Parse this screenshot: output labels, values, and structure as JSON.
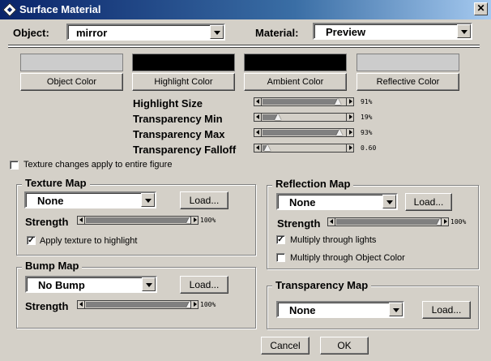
{
  "window": {
    "title": "Surface Material",
    "close_glyph": "✕"
  },
  "object": {
    "label": "Object:",
    "value": "mirror"
  },
  "material": {
    "label": "Material:",
    "value": "Preview"
  },
  "colors": {
    "object": {
      "label": "Object Color",
      "swatch": "#cccccc"
    },
    "highlight": {
      "label": "Highlight Color",
      "swatch": "#000000"
    },
    "ambient": {
      "label": "Ambient Color",
      "swatch": "#000000"
    },
    "reflective": {
      "label": "Reflective Color",
      "swatch": "#cccccc"
    }
  },
  "sliders": {
    "highlight_size": {
      "label": "Highlight Size",
      "value": 0.91,
      "display": "91%"
    },
    "transparency_min": {
      "label": "Transparency Min",
      "value": 0.19,
      "display": "19%"
    },
    "transparency_max": {
      "label": "Transparency Max",
      "value": 0.93,
      "display": "93%"
    },
    "transparency_falloff": {
      "label": "Transparency Falloff",
      "value": 0.06,
      "display": "0.60"
    }
  },
  "texture_all": {
    "label": "Texture changes apply to entire figure",
    "checked": false
  },
  "texture_map": {
    "title": "Texture Map",
    "value": "None",
    "load": "Load...",
    "strength_label": "Strength",
    "strength": 1.0,
    "strength_display": "100%",
    "apply_highlight": {
      "label": "Apply texture to highlight",
      "checked": true
    }
  },
  "bump_map": {
    "title": "Bump Map",
    "value": "No Bump",
    "load": "Load...",
    "strength_label": "Strength",
    "strength": 1.0,
    "strength_display": "100%"
  },
  "reflection_map": {
    "title": "Reflection Map",
    "value": "None",
    "load": "Load...",
    "strength_label": "Strength",
    "strength": 1.0,
    "strength_display": "100%",
    "multiply_lights": {
      "label": "Multiply through lights",
      "checked": true
    },
    "multiply_object": {
      "label": "Multiply through Object Color",
      "checked": false
    }
  },
  "transparency_map": {
    "title": "Transparency Map",
    "value": "None",
    "load": "Load..."
  },
  "buttons": {
    "cancel": "Cancel",
    "ok": "OK"
  },
  "check_glyph": "✓"
}
